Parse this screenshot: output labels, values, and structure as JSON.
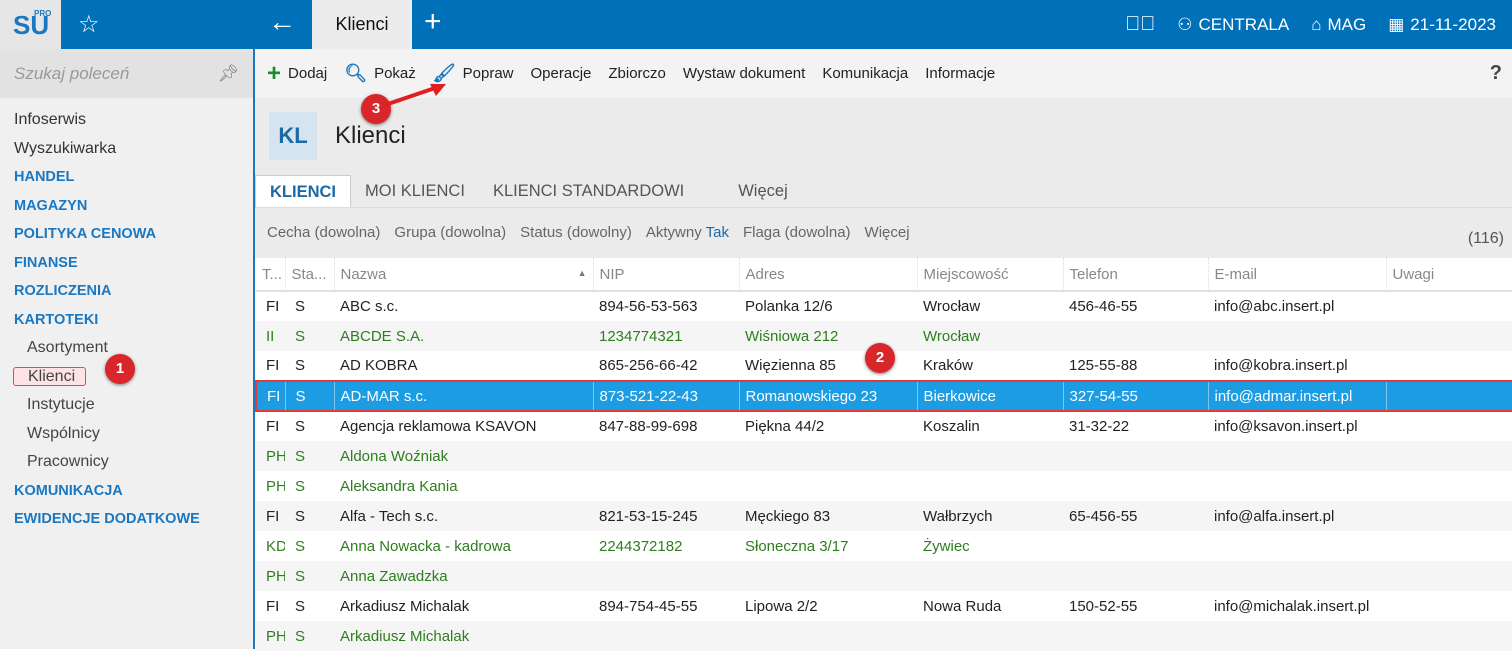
{
  "topbar": {
    "logo": "SU",
    "logo_sup": "PRO",
    "tab": "Klienci",
    "branch": "CENTRALA",
    "warehouse": "MAG",
    "date": "21-11-2023"
  },
  "sidebar": {
    "search_placeholder": "Szukaj poleceń",
    "items": [
      {
        "label": "Infoserwis",
        "type": "item"
      },
      {
        "label": "Wyszukiwarka",
        "type": "item"
      },
      {
        "label": "HANDEL",
        "type": "sec"
      },
      {
        "label": "MAGAZYN",
        "type": "sec"
      },
      {
        "label": "POLITYKA CENOWA",
        "type": "sec"
      },
      {
        "label": "FINANSE",
        "type": "sec"
      },
      {
        "label": "ROZLICZENIA",
        "type": "sec"
      },
      {
        "label": "KARTOTEKI",
        "type": "sec"
      },
      {
        "label": "Asortyment",
        "type": "sub"
      },
      {
        "label": "Klienci",
        "type": "active"
      },
      {
        "label": "Instytucje",
        "type": "sub"
      },
      {
        "label": "Wspólnicy",
        "type": "sub"
      },
      {
        "label": "Pracownicy",
        "type": "sub"
      },
      {
        "label": "KOMUNIKACJA",
        "type": "sec"
      },
      {
        "label": "EWIDENCJE DODATKOWE",
        "type": "sec"
      }
    ]
  },
  "toolbar": {
    "add": "Dodaj",
    "show": "Pokaż",
    "edit": "Popraw",
    "operations": "Operacje",
    "bulk": "Zbiorczo",
    "issue": "Wystaw dokument",
    "comm": "Komunikacja",
    "info": "Informacje",
    "help": "?"
  },
  "header": {
    "code": "KL",
    "title": "Klienci"
  },
  "tabs": [
    "KLIENCI",
    "MOI KLIENCI",
    "KLIENCI STANDARDOWI",
    "Więcej"
  ],
  "filters": {
    "cecha": "Cecha (dowolna)",
    "grupa": "Grupa (dowolna)",
    "status": "Status (dowolny)",
    "aktywny": "Aktywny",
    "aktywny_val": "Tak",
    "flaga": "Flaga (dowolna)",
    "more": "Więcej",
    "count": "(116)"
  },
  "badges": [
    "1",
    "2",
    "3"
  ],
  "columns": [
    "T...",
    "Sta...",
    "Nazwa",
    "NIP",
    "Adres",
    "Miejscowość",
    "Telefon",
    "E-mail",
    "Uwagi"
  ],
  "rows": [
    [
      "FI",
      "S",
      "ABC s.c.",
      "894-56-53-563",
      "Polanka  12/6",
      "Wrocław",
      "456-46-55",
      "info@abc.insert.pl",
      ""
    ],
    [
      "II",
      "S",
      "ABCDE S.A.",
      "1234774321",
      "Wiśniowa 212",
      "Wrocław",
      "",
      "",
      ""
    ],
    [
      "FI",
      "S",
      "AD KOBRA",
      "865-256-66-42",
      "Więzienna  85",
      "Kraków",
      "125-55-88",
      "info@kobra.insert.pl",
      ""
    ],
    [
      "FI",
      "S",
      "AD-MAR s.c.",
      "873-521-22-43",
      "Romanowskiego 23",
      "Bierkowice",
      "327-54-55",
      "info@admar.insert.pl",
      ""
    ],
    [
      "FI",
      "S",
      "Agencja reklamowa KSAVON",
      "847-88-99-698",
      "Piękna  44/2",
      "Koszalin",
      "31-32-22",
      "info@ksavon.insert.pl",
      ""
    ],
    [
      "PH",
      "S",
      "Aldona Woźniak",
      "",
      "",
      "",
      "",
      "",
      ""
    ],
    [
      "PH",
      "S",
      "Aleksandra Kania",
      "",
      "",
      "",
      "",
      "",
      ""
    ],
    [
      "FI",
      "S",
      "Alfa - Tech s.c.",
      "821-53-15-245",
      "Męckiego  83",
      "Wałbrzych",
      "65-456-55",
      "info@alfa.insert.pl",
      ""
    ],
    [
      "KD",
      "S",
      "Anna Nowacka - kadrowa",
      "2244372182",
      "Słoneczna 3/17",
      "Żywiec",
      "",
      "",
      ""
    ],
    [
      "PH",
      "S",
      "Anna Zawadzka",
      "",
      "",
      "",
      "",
      "",
      ""
    ],
    [
      "FI",
      "S",
      "Arkadiusz Michalak",
      "894-754-45-55",
      "Lipowa  2/2",
      "Nowa Ruda",
      "150-52-55",
      "info@michalak.insert.pl",
      ""
    ],
    [
      "PH",
      "S",
      "Arkadiusz Michalak",
      "",
      "",
      "",
      "",
      "",
      ""
    ]
  ],
  "green_rows": [
    1,
    5,
    6,
    8,
    9,
    11
  ],
  "selected_row": 3
}
